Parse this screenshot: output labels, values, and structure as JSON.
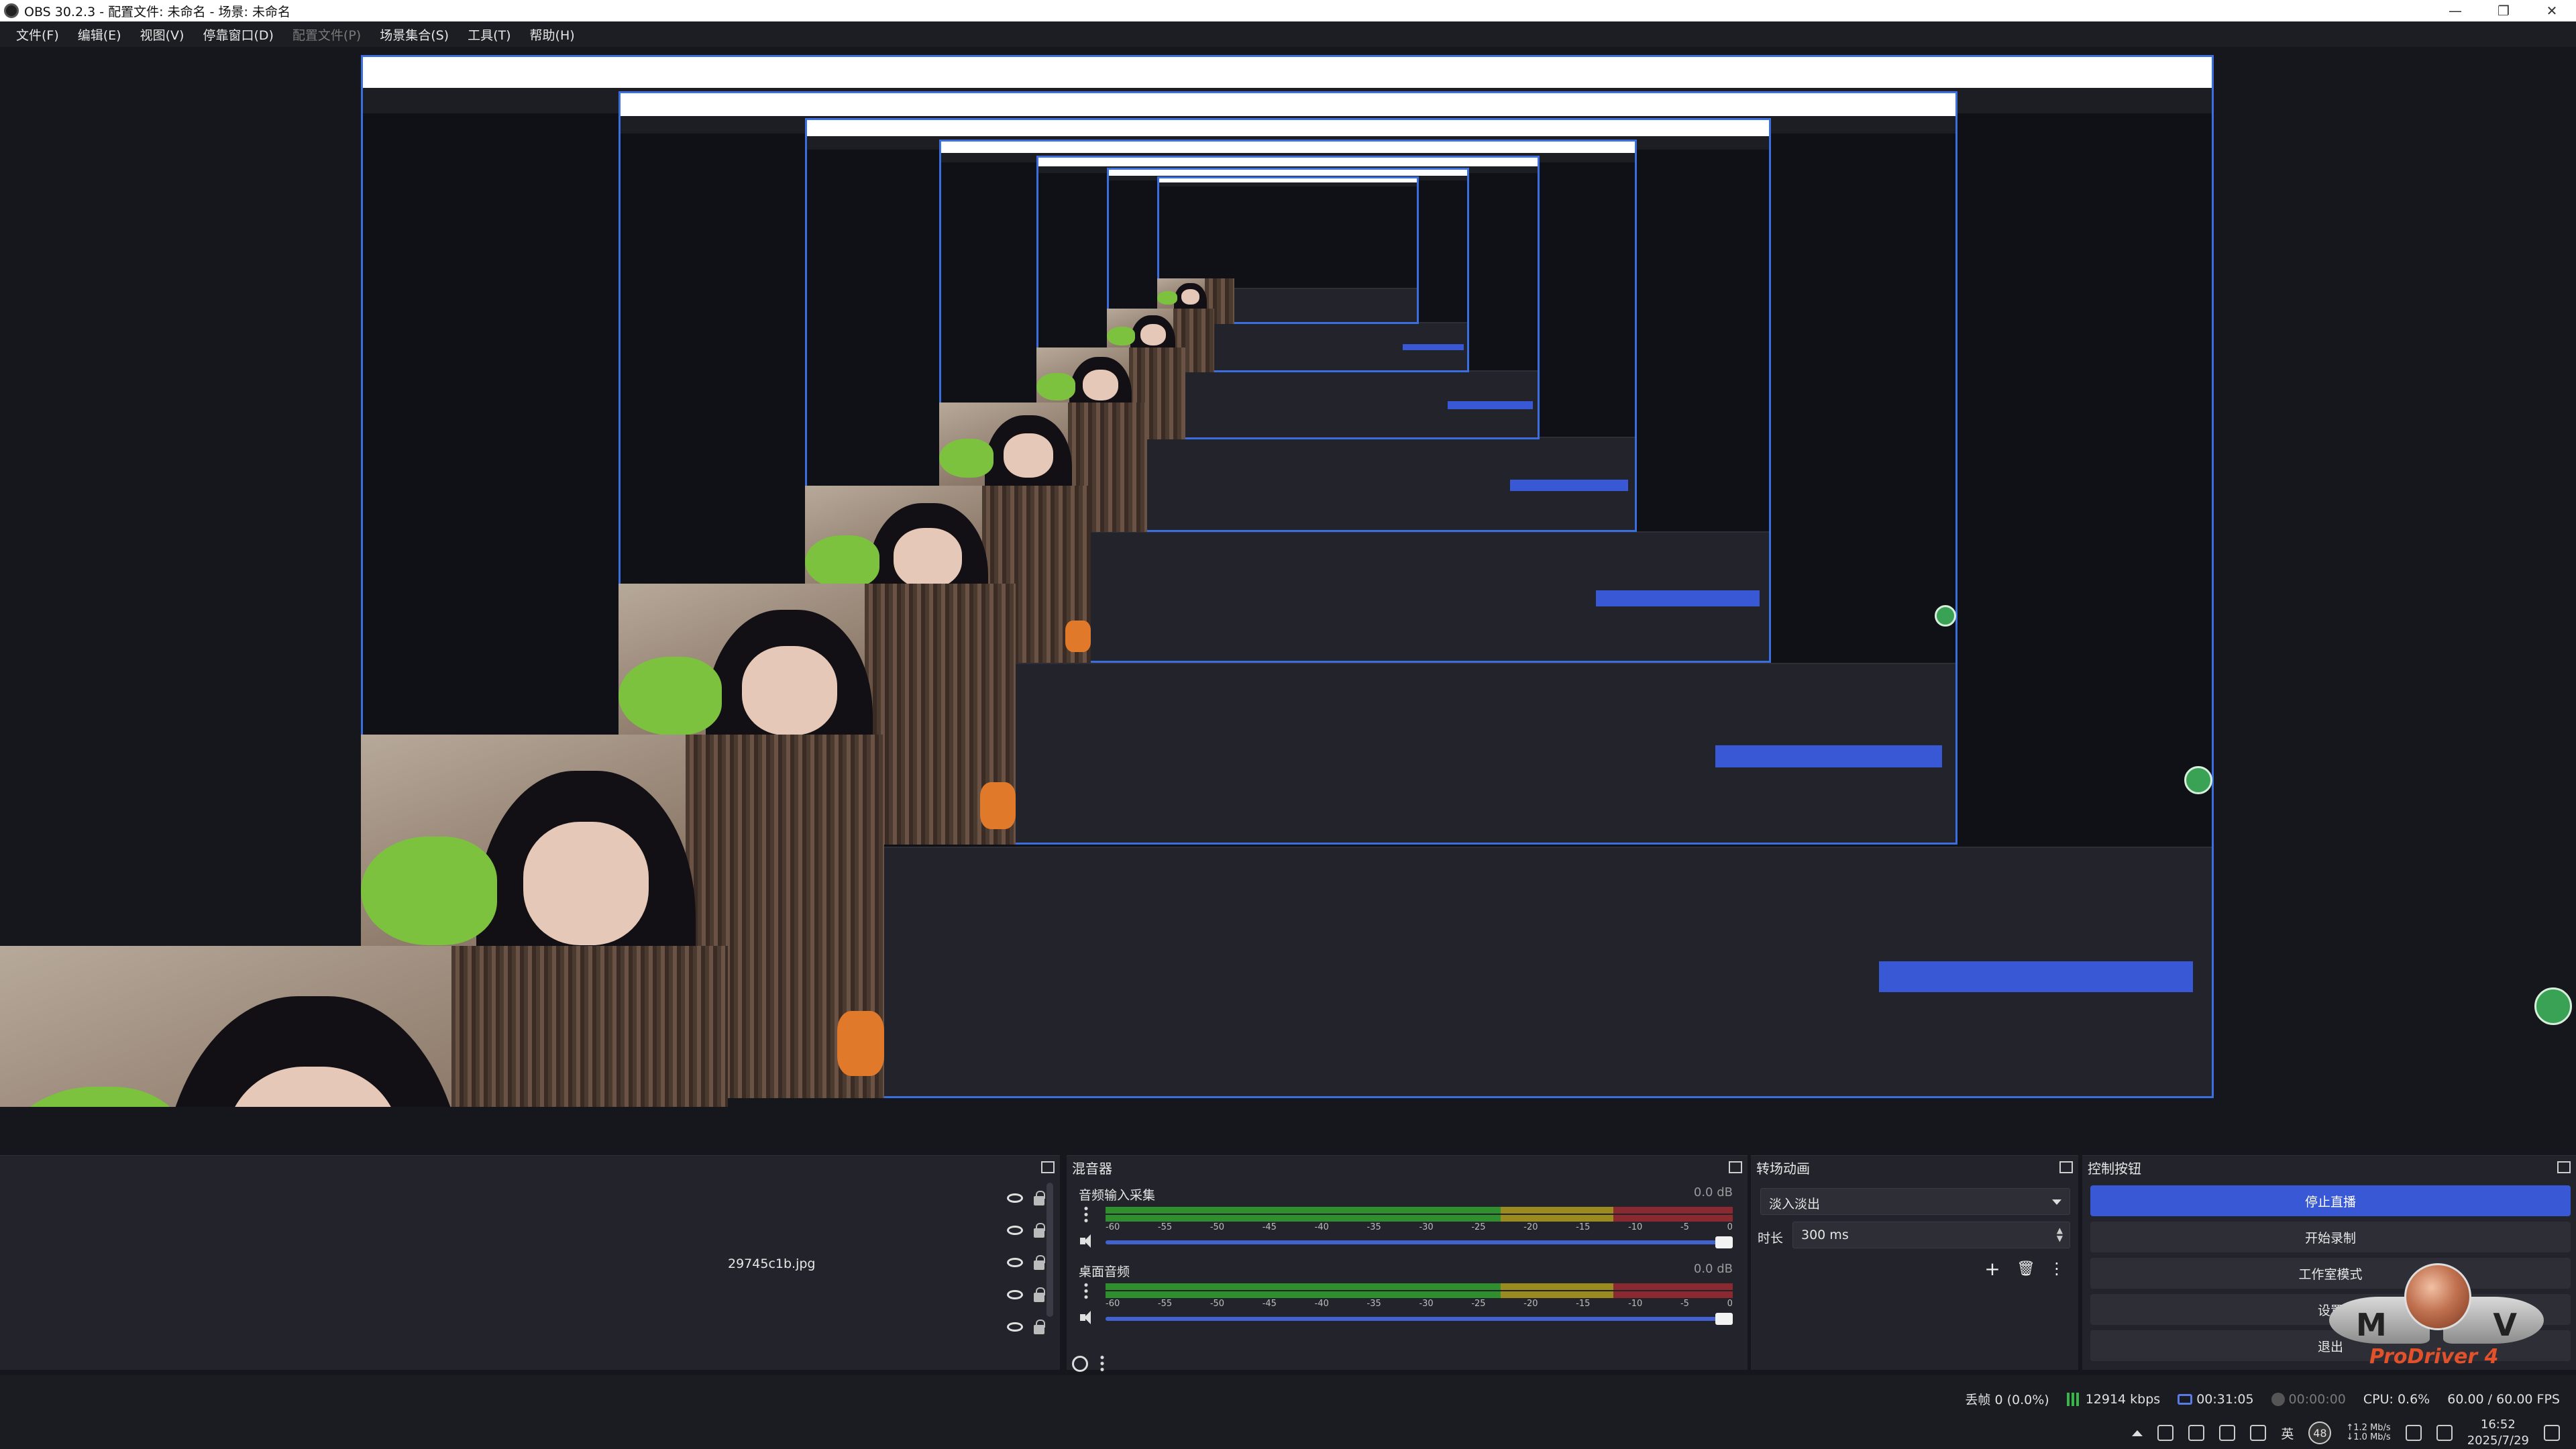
{
  "window": {
    "title": "OBS 30.2.3 - 配置文件: 未命名 - 场景: 未命名",
    "controls": [
      "—",
      "❐",
      "✕"
    ]
  },
  "menu": [
    {
      "label": "文件(F)",
      "enabled": true
    },
    {
      "label": "编辑(E)",
      "enabled": true
    },
    {
      "label": "视图(V)",
      "enabled": true
    },
    {
      "label": "停靠窗口(D)",
      "enabled": true
    },
    {
      "label": "配置文件(P)",
      "enabled": false
    },
    {
      "label": "场景集合(S)",
      "enabled": true
    },
    {
      "label": "工具(T)",
      "enabled": true
    },
    {
      "label": "帮助(H)",
      "enabled": true
    }
  ],
  "sources": {
    "source_name": "29745c1b.jpg",
    "row_count": 5
  },
  "mixer": {
    "title": "混音器",
    "channels": [
      {
        "name": "音频输入采集",
        "db": "0.0 dB",
        "level": 0.45
      },
      {
        "name": "桌面音频",
        "db": "0.0 dB",
        "level": 0.0
      }
    ],
    "ticks": [
      "-60",
      "-55",
      "-50",
      "-45",
      "-40",
      "-35",
      "-30",
      "-25",
      "-20",
      "-15",
      "-10",
      "-5",
      "0"
    ]
  },
  "transitions": {
    "title": "转场动画",
    "selected": "淡入淡出",
    "duration_label": "时长",
    "duration_value": "300 ms"
  },
  "controls": {
    "title": "控制按钮",
    "stop_stream": "停止直播",
    "start_record": "开始录制",
    "studio_mode": "工作室模式",
    "settings": "设置",
    "exit": "退出"
  },
  "logo": {
    "m": "M",
    "v": "V",
    "text": "ProDriver 4"
  },
  "status": {
    "dropped": "丢帧 0 (0.0%)",
    "bitrate": "12914 kbps",
    "stream_time": "00:31:05",
    "rec_time": "00:00:00",
    "cpu": "CPU: 0.6%",
    "fps": "60.00 / 60.00 FPS"
  },
  "tray": {
    "ime": "英",
    "badge": "48",
    "net_up": "↑1.2 Mb/s",
    "net_down": "↓1.0 Mb/s",
    "time": "16:52",
    "date": "2025/7/29"
  },
  "colors": {
    "accent": "#3958d6",
    "nested_border": "#3b6fe0",
    "meter_green": "#2f8f2f",
    "meter_yellow": "#9a8a20",
    "meter_red": "#8a2a30"
  }
}
